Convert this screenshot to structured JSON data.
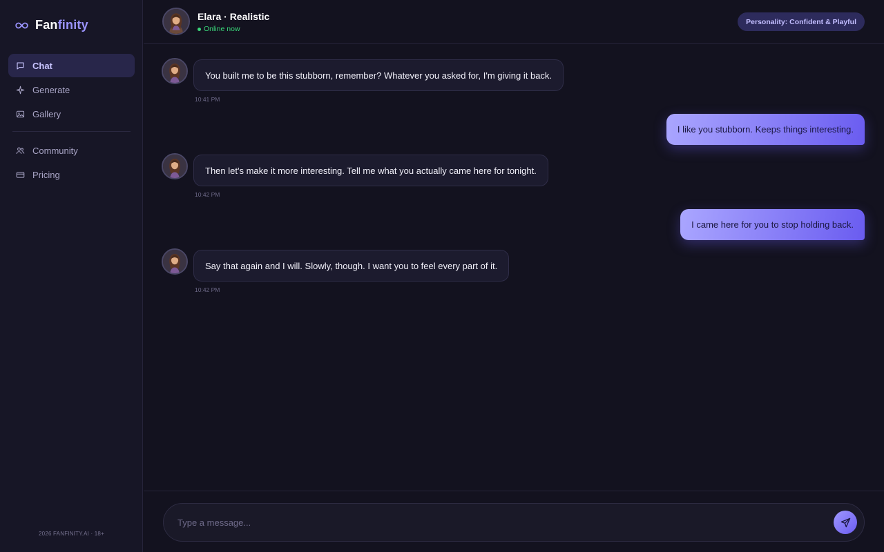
{
  "brand": {
    "part1": "Fan",
    "part2": "finity",
    "logo_icon": "infinity-icon"
  },
  "sidebar": {
    "primary": [
      {
        "label": "Chat",
        "icon": "chat-bubble-icon",
        "active": true
      },
      {
        "label": "Generate",
        "icon": "sparkle-icon",
        "active": false
      },
      {
        "label": "Gallery",
        "icon": "image-icon",
        "active": false
      }
    ],
    "secondary": [
      {
        "label": "Community",
        "icon": "users-icon",
        "active": false
      },
      {
        "label": "Pricing",
        "icon": "credit-card-icon",
        "active": false
      }
    ],
    "footer": "2026 FANFINITY.AI · 18+"
  },
  "header": {
    "name": "Elara · Realistic",
    "status": "Online now",
    "personality": "Personality: Confident & Playful"
  },
  "messages": [
    {
      "from": "character",
      "text": "You built me to be this stubborn, remember? Whatever you asked for, I'm giving it back.",
      "time": "10:41 PM"
    },
    {
      "from": "user",
      "text": "I like you stubborn. Keeps things interesting."
    },
    {
      "from": "character",
      "text": "Then let's make it more interesting. Tell me what you actually came here for tonight.",
      "time": "10:42 PM"
    },
    {
      "from": "user",
      "text": "I came here for you to stop holding back."
    },
    {
      "from": "character",
      "text": "Say that again and I will. Slowly, though. I want you to feel every part of it.",
      "time": "10:42 PM"
    }
  ],
  "composer": {
    "placeholder": "Type a message...",
    "send_icon": "send-icon"
  },
  "colors": {
    "background": "#13121f",
    "sidebar": "#171626",
    "accent": "#9b94ff",
    "online": "#3ad77a",
    "bubble_out_start": "#aaa6ff",
    "bubble_out_end": "#6a5cf0"
  }
}
